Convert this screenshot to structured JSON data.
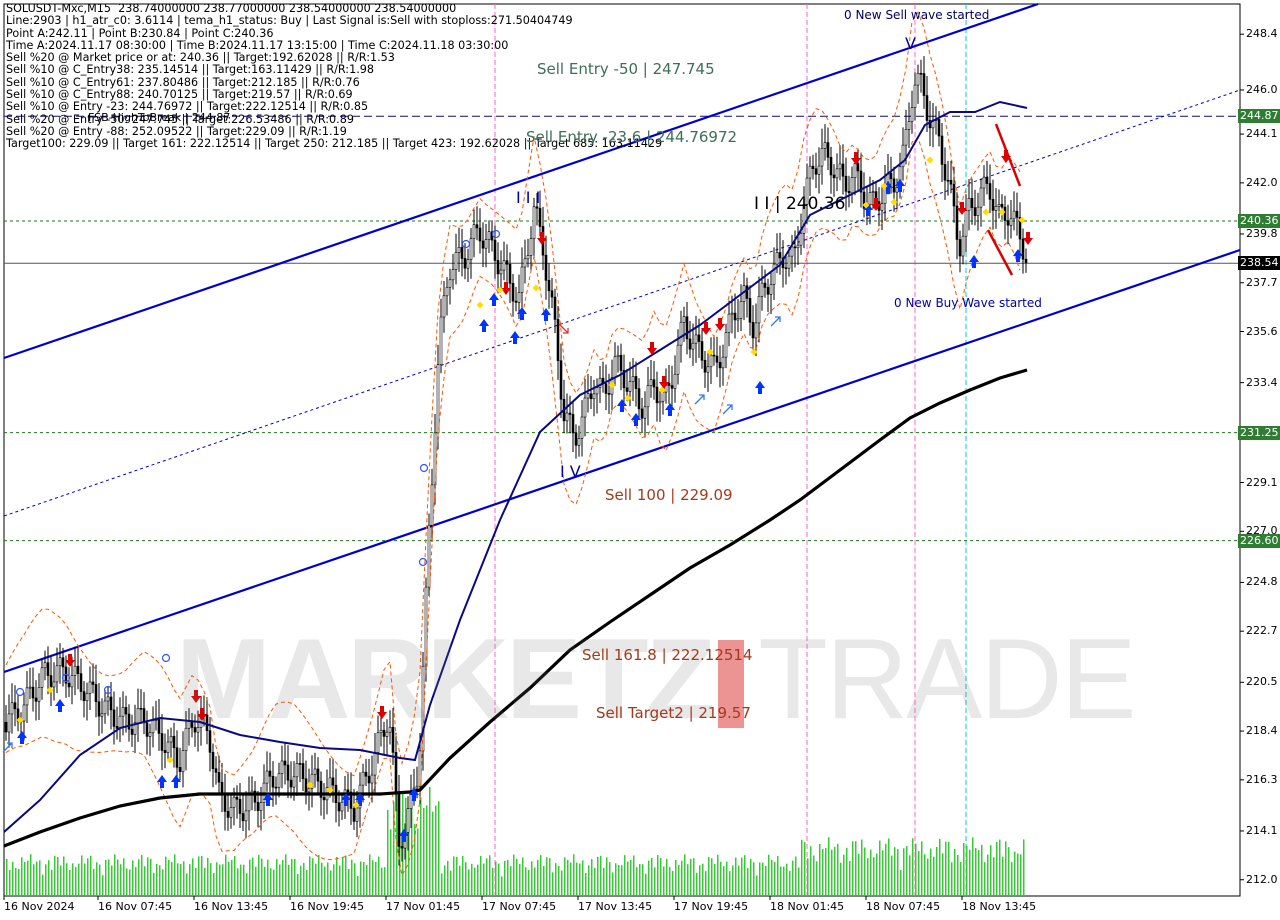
{
  "info_lines": [
    "SOLUSDT-Mxc,M15  238.74000000 238.77000000 238.54000000 238.54000000",
    "Line:2903 | h1_atr_c0: 3.6114 | tema_h1_status: Buy | Last Signal is:Sell with stoploss:271.50404749",
    "Point A:242.11 | Point B:230.84 | Point C:240.36",
    "Time A:2024.11.17 08:30:00 | Time B:2024.11.17 13:15:00 | Time C:2024.11.18 03:30:00",
    "Sell %20 @ Market price or at: 240.36 || Target:192.62028 || R/R:1.53",
    "Sell %10 @ C_Entry38: 235.14514 || Target:163.11429 || R/R:1.98",
    "Sell %10 @ C_Entry61: 237.80486 || Target:212.185 || R/R:0.76",
    "Sell %10 @ C_Entry88: 240.70125 || Target:219.57 || R/R:0.69",
    "Sell %10 @ Entry -23: 244.76972 || Target:222.12514 || R/R:0.85",
    "Sell %20 @ Entry -50: 247.745 || Target:226.53486 || R/R:0.89",
    "Sell %20 @ Entry -88: 252.09522 || Target:229.09 || R/R:1.19",
    "Target100: 229.09 || Target 161: 222.12514 || Target 250: 212.185 || Target 423: 192.62028 || Target 685: 163.11429"
  ],
  "fsb_label": "FSB-HighToBreak | 244.87",
  "watermark": {
    "left": "MARKETZ",
    "right": "TRADE"
  },
  "annotations": {
    "sell_entry_50": "Sell Entry -50 | 247.745",
    "sell_entry_236": "Sell Entry -23.6 | 244.76972",
    "sell_100": "Sell 100 | 229.09",
    "sell_1618": "Sell 161.8 | 222.12514",
    "sell_target2": "Sell Target2 | 219.57",
    "new_sell_wave": "0 New Sell wave started",
    "new_buy_wave": "0 New Buy Wave started",
    "point_c": "I I | 240.36",
    "wave_iii": "I I I",
    "wave_iv": "I V",
    "wave_v": "V"
  },
  "price_tags": [
    {
      "label": "244.87",
      "value": 244.87,
      "bg": "#2e7d32",
      "fg": "#ffffff"
    },
    {
      "label": "240.36",
      "value": 240.36,
      "bg": "#2e7d32",
      "fg": "#ffffff"
    },
    {
      "label": "238.54",
      "value": 238.54,
      "bg": "#000000",
      "fg": "#ffffff"
    },
    {
      "label": "231.25",
      "value": 231.25,
      "bg": "#2e7d32",
      "fg": "#ffffff"
    },
    {
      "label": "226.60",
      "value": 226.6,
      "bg": "#2e7d32",
      "fg": "#ffffff"
    }
  ],
  "colors": {
    "channel": "#0000cc",
    "tema": "#0a0a80",
    "ma": "#000000",
    "green_level": "#1a7a1a",
    "band": "#ff5500",
    "volume": "#33cc33",
    "sell_arrow": "#dd0000",
    "buy_arrow": "#0033ff",
    "vline_pink": "#ff66cc",
    "vline_cyan": "#00cccc"
  },
  "chart_data": {
    "type": "candlestick",
    "symbol": "SOLUSDT-Mxc",
    "timeframe": "M15",
    "y_axis": {
      "min": 211.3,
      "max": 249.7,
      "ticks": [
        248.4,
        246.0,
        244.1,
        242.0,
        239.8,
        237.7,
        235.6,
        233.4,
        231.2,
        229.1,
        227.0,
        224.8,
        222.7,
        220.5,
        218.4,
        216.3,
        214.1,
        212.0
      ]
    },
    "x_ticks": [
      "16 Nov 2024",
      "16 Nov 07:45",
      "16 Nov 13:45",
      "16 Nov 19:45",
      "17 Nov 01:45",
      "17 Nov 07:45",
      "17 Nov 13:45",
      "17 Nov 19:45",
      "18 Nov 01:45",
      "18 Nov 07:45",
      "18 Nov 13:45"
    ],
    "levels": {
      "fsb_high_to_break": 244.87,
      "point_c": 240.36,
      "last_price": 238.54,
      "target_1": 231.25,
      "target_2": 226.6
    },
    "points": {
      "A": 242.11,
      "B": 230.84,
      "C": 240.36
    },
    "close_path": [
      [
        0,
        218.7
      ],
      [
        20,
        219.5
      ],
      [
        40,
        220.8
      ],
      [
        60,
        221.0
      ],
      [
        80,
        220.3
      ],
      [
        100,
        219.4
      ],
      [
        120,
        218.8
      ],
      [
        140,
        218.9
      ],
      [
        160,
        218.0
      ],
      [
        175,
        217.1
      ],
      [
        190,
        219.0
      ],
      [
        205,
        218.3
      ],
      [
        215,
        215.6
      ],
      [
        230,
        215.0
      ],
      [
        250,
        215.3
      ],
      [
        270,
        216.5
      ],
      [
        290,
        216.6
      ],
      [
        310,
        216.2
      ],
      [
        330,
        215.7
      ],
      [
        350,
        215.1
      ],
      [
        370,
        217.2
      ],
      [
        385,
        219.2
      ],
      [
        395,
        213.6
      ],
      [
        405,
        214.8
      ],
      [
        415,
        217.0
      ],
      [
        425,
        227.0
      ],
      [
        435,
        235.0
      ],
      [
        445,
        238.4
      ],
      [
        460,
        238.8
      ],
      [
        475,
        240.0
      ],
      [
        490,
        239.0
      ],
      [
        500,
        238.2
      ],
      [
        515,
        237.0
      ],
      [
        530,
        240.9
      ],
      [
        540,
        239.0
      ],
      [
        550,
        236.0
      ],
      [
        560,
        232.1
      ],
      [
        570,
        231.0
      ],
      [
        580,
        232.0
      ],
      [
        590,
        233.5
      ],
      [
        600,
        232.8
      ],
      [
        610,
        234.2
      ],
      [
        620,
        233.7
      ],
      [
        630,
        233.0
      ],
      [
        640,
        232.3
      ],
      [
        650,
        233.4
      ],
      [
        660,
        232.5
      ],
      [
        670,
        234.0
      ],
      [
        680,
        236.0
      ],
      [
        690,
        235.0
      ],
      [
        700,
        234.5
      ],
      [
        710,
        234.0
      ],
      [
        720,
        235.0
      ],
      [
        730,
        236.5
      ],
      [
        740,
        237.0
      ],
      [
        750,
        235.8
      ],
      [
        760,
        237.5
      ],
      [
        770,
        238.2
      ],
      [
        780,
        238.9
      ],
      [
        790,
        238.6
      ],
      [
        800,
        241.2
      ],
      [
        810,
        242.9
      ],
      [
        820,
        243.2
      ],
      [
        830,
        242.7
      ],
      [
        840,
        241.9
      ],
      [
        850,
        242.4
      ],
      [
        860,
        241.5
      ],
      [
        870,
        241.0
      ],
      [
        880,
        241.7
      ],
      [
        890,
        242.0
      ],
      [
        900,
        243.2
      ],
      [
        910,
        246.5
      ],
      [
        918,
        246.1
      ],
      [
        925,
        244.9
      ],
      [
        935,
        243.8
      ],
      [
        945,
        241.9
      ],
      [
        955,
        239.3
      ],
      [
        965,
        240.8
      ],
      [
        975,
        241.4
      ],
      [
        985,
        241.9
      ],
      [
        995,
        240.5
      ],
      [
        1005,
        240.8
      ],
      [
        1015,
        239.8
      ],
      [
        1025,
        238.54
      ]
    ]
  }
}
